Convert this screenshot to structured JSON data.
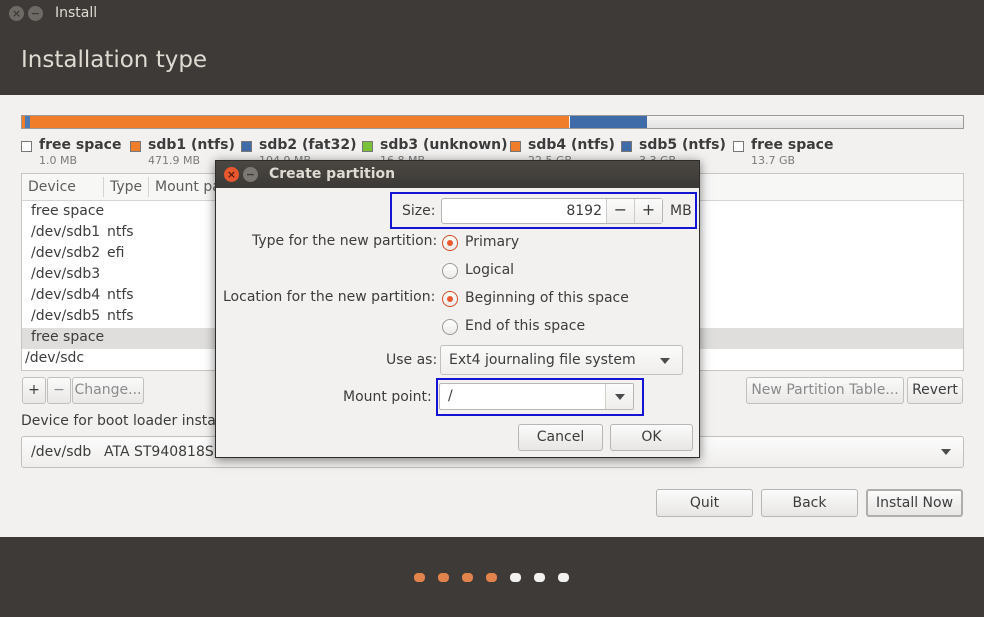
{
  "window": {
    "title": "Install",
    "page_title": "Installation type"
  },
  "partition_bar": [
    {
      "color": "#ef7d2a",
      "frac_start": 0.0,
      "frac_width": 0.003
    },
    {
      "color": "#4e7ab4",
      "frac_start": 0.003,
      "frac_width": 0.006
    },
    {
      "color": "#ef7d2a",
      "frac_start": 0.009,
      "frac_width": 0.573
    },
    {
      "color": "#3f6ca8",
      "frac_start": 0.582,
      "frac_width": 0.082
    }
  ],
  "legend": [
    {
      "name": "free space",
      "size": "1.0 MB",
      "color": "#ffffff"
    },
    {
      "name": "sdb1 (ntfs)",
      "size": "471.9 MB",
      "color": "#ef7d2a"
    },
    {
      "name": "sdb2 (fat32)",
      "size": "104.9 MB",
      "color": "#3f6ca8"
    },
    {
      "name": "sdb3 (unknown)",
      "size": "16.8 MB",
      "color": "#7ac13a"
    },
    {
      "name": "sdb4 (ntfs)",
      "size": "22.5 GB",
      "color": "#ef7d2a"
    },
    {
      "name": "sdb5 (ntfs)",
      "size": "3.3 GB",
      "color": "#3f6ca8"
    },
    {
      "name": "free space",
      "size": "13.7 GB",
      "color": "#ffffff"
    }
  ],
  "table": {
    "headers": [
      "Device",
      "Type",
      "Mount pa"
    ],
    "rows": [
      {
        "device": "free space",
        "type": ""
      },
      {
        "device": "/dev/sdb1",
        "type": "ntfs"
      },
      {
        "device": "/dev/sdb2",
        "type": "efi"
      },
      {
        "device": "/dev/sdb3",
        "type": ""
      },
      {
        "device": "/dev/sdb4",
        "type": "ntfs"
      },
      {
        "device": "/dev/sdb5",
        "type": "ntfs"
      },
      {
        "device": "free space",
        "type": ""
      },
      {
        "device": "/dev/sdc",
        "type": ""
      }
    ]
  },
  "table_buttons": {
    "add": "+",
    "remove": "−",
    "change": "Change...",
    "new_table": "New Partition Table...",
    "revert": "Revert"
  },
  "boot": {
    "label": "Device for boot loader instal",
    "device": "/dev/sdb",
    "model": "ATA ST940818SM"
  },
  "nav": {
    "quit": "Quit",
    "back": "Back",
    "install": "Install Now"
  },
  "progress_dots": [
    {
      "color": "#e2834c"
    },
    {
      "color": "#e2834c"
    },
    {
      "color": "#e2834c"
    },
    {
      "color": "#e2834c"
    },
    {
      "color": "#f2f1f0"
    },
    {
      "color": "#f2f1f0"
    },
    {
      "color": "#f2f1f0"
    }
  ],
  "dialog": {
    "title": "Create partition",
    "size_label": "Size:",
    "size_value": "8192",
    "size_unit": "MB",
    "minus": "−",
    "plus": "+",
    "type_label": "Type for the new partition:",
    "type_primary": "Primary",
    "type_logical": "Logical",
    "location_label": "Location for the new partition:",
    "location_beginning": "Beginning of this space",
    "location_end": "End of this space",
    "use_as_label": "Use as:",
    "use_as_value": "Ext4 journaling file system",
    "mount_label": "Mount point:",
    "mount_value": "/",
    "cancel": "Cancel",
    "ok": "OK"
  }
}
